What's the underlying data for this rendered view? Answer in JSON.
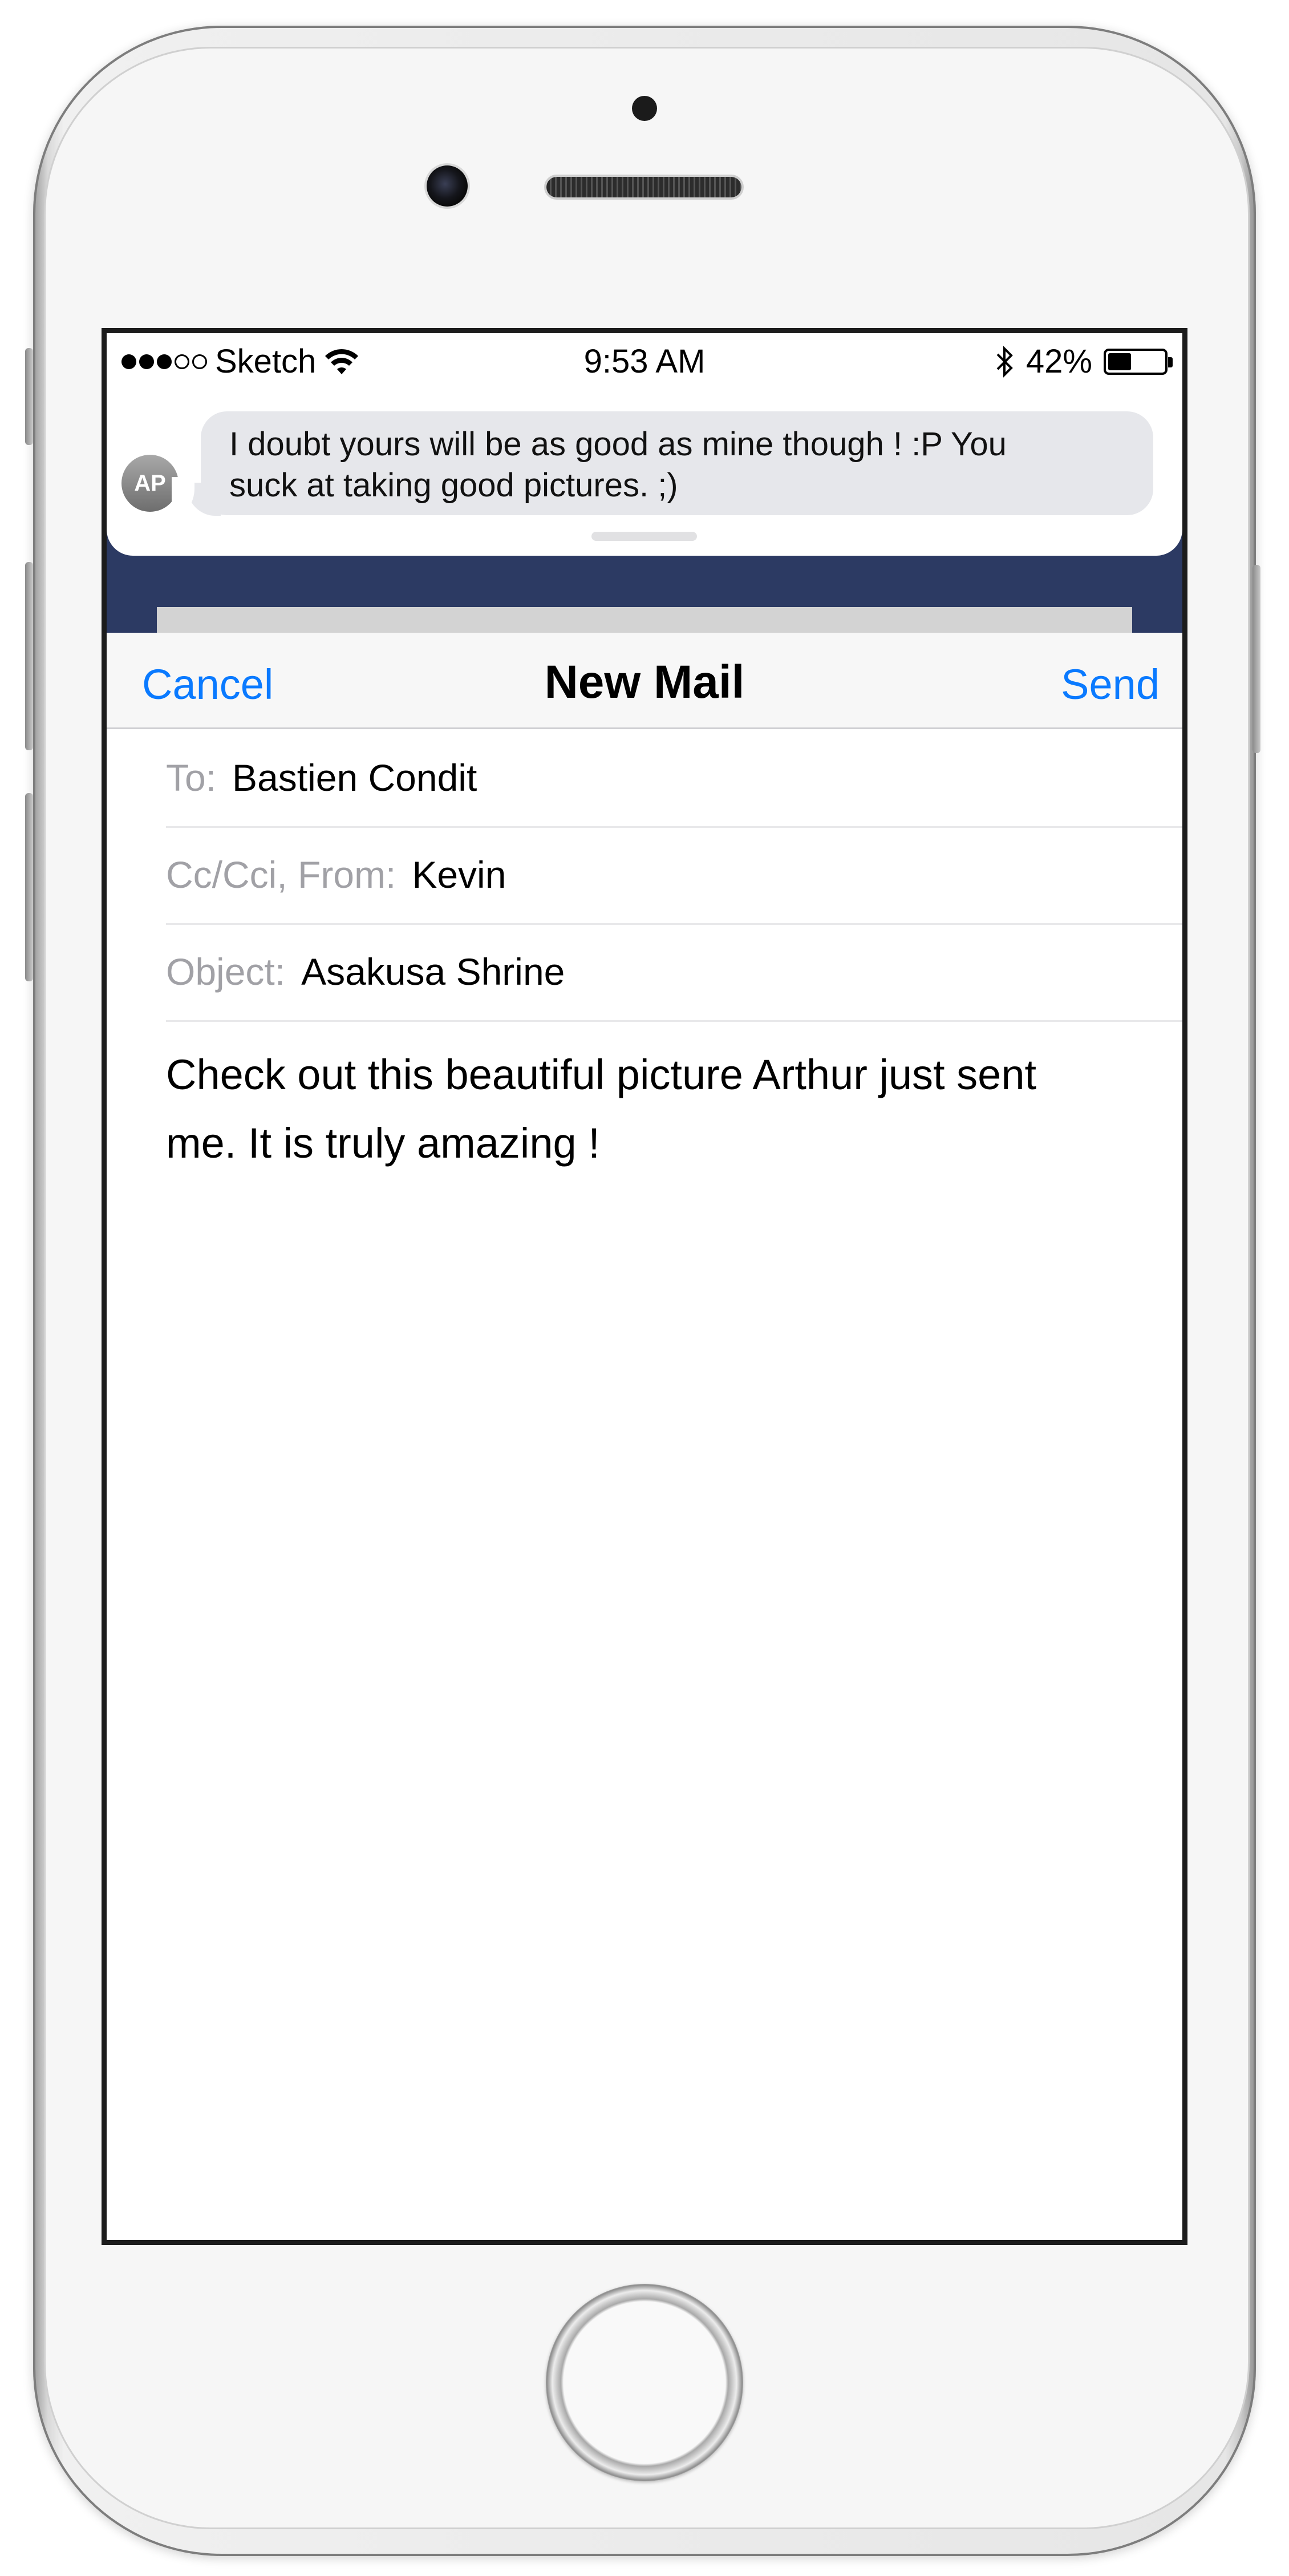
{
  "status_bar": {
    "carrier": "Sketch",
    "time": "9:53 AM",
    "battery_percent": "42%",
    "battery_level": 0.42,
    "signal_bars_filled": 3,
    "signal_bars_total": 5
  },
  "notification": {
    "avatar_initials": "AP",
    "message_line1": "I doubt yours will be as good as mine though ! :P You",
    "message_line2": "suck at taking good pictures. ;)"
  },
  "mail": {
    "nav": {
      "cancel_label": "Cancel",
      "title": "New Mail",
      "send_label": "Send"
    },
    "to": {
      "label": "To:",
      "value": "Bastien Condit"
    },
    "cc": {
      "label": "Cc/Cci, From:",
      "value": "Kevin"
    },
    "subject": {
      "label": "Object:",
      "value": "Asakusa Shrine"
    },
    "body_line1": "Check out this beautiful picture Arthur just sent",
    "body_line2": "me. It is truly amazing !"
  },
  "colors": {
    "accent": "#0a7aff",
    "label_gray": "#a1a1a6",
    "banner_backdrop": "#2c3a63",
    "bubble": "#e6e7eb"
  }
}
